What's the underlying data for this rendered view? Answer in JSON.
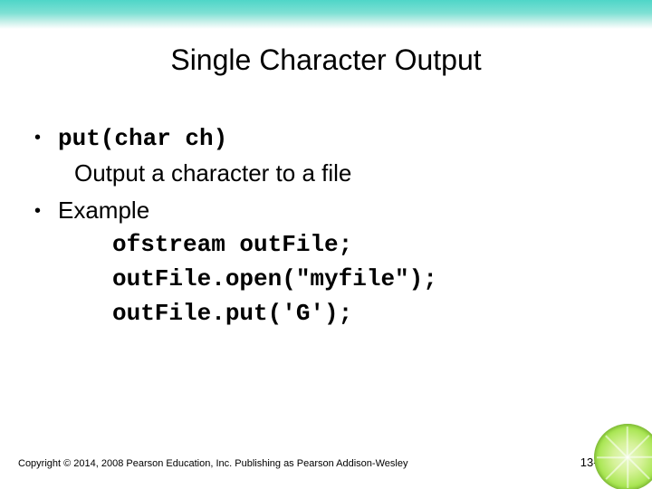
{
  "title": "Single Character Output",
  "bullets": {
    "b1_code": "put(char ch)",
    "b1_desc": "Output a character to a file",
    "b2_label": "Example"
  },
  "code": {
    "l1": "ofstream outFile;",
    "l2": "outFile.open(\"myfile\");",
    "l3": "outFile.put('G');"
  },
  "footer": "Copyright © 2014, 2008 Pearson Education, Inc. Publishing as Pearson Addison-Wesley",
  "page": "13-19"
}
